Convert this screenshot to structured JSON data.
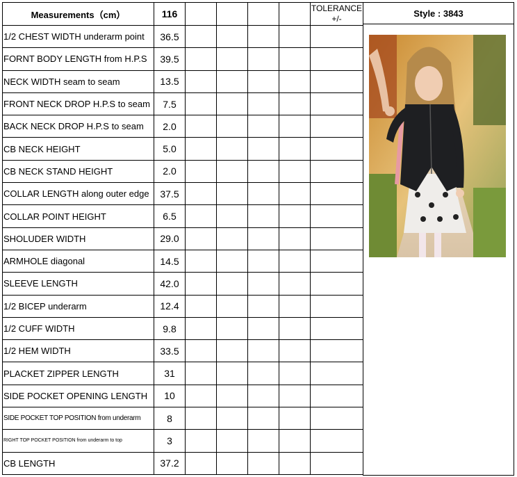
{
  "header": {
    "title": "Measurements（cm）",
    "size": "116",
    "tolerance": "TOLERANCE +/-",
    "style": "Style : 3843"
  },
  "rows": [
    {
      "label": "1/2 CHEST WIDTH underarm point",
      "value": "36.5"
    },
    {
      "label": "FORNT BODY LENGTH from H.P.S",
      "value": "39.5"
    },
    {
      "label": "NECK WIDTH seam to seam",
      "value": "13.5"
    },
    {
      "label": "FRONT NECK DROP  H.P.S to seam",
      "value": "7.5"
    },
    {
      "label": "BACK NECK DROP  H.P.S to seam",
      "value": "2.0"
    },
    {
      "label": "CB NECK HEIGHT",
      "value": "5.0"
    },
    {
      "label": "CB NECK STAND HEIGHT",
      "value": "2.0"
    },
    {
      "label": "COLLAR LENGTH along outer edge",
      "value": "37.5"
    },
    {
      "label": "COLLAR POINT HEIGHT",
      "value": "6.5"
    },
    {
      "label": "SHOLUDER WIDTH",
      "value": "29.0"
    },
    {
      "label": "ARMHOLE diagonal",
      "value": "14.5"
    },
    {
      "label": "SLEEVE LENGTH",
      "value": "42.0"
    },
    {
      "label": "1/2 BICEP underarm",
      "value": "12.4"
    },
    {
      "label": "1/2 CUFF WIDTH",
      "value": "9.8"
    },
    {
      "label": "1/2 HEM WIDTH",
      "value": "33.5"
    },
    {
      "label": "PLACKET ZIPPER LENGTH",
      "value": "31"
    },
    {
      "label": "SIDE POCKET OPENING LENGTH",
      "value": "10"
    },
    {
      "label": "SIDE POCKET TOP POSITION from underarm",
      "value": "8"
    },
    {
      "label": "RIGHT TOP POCKET POSITION from underarm to top",
      "value": "3"
    },
    {
      "label": "CB LENGTH",
      "value": "37.2"
    }
  ]
}
